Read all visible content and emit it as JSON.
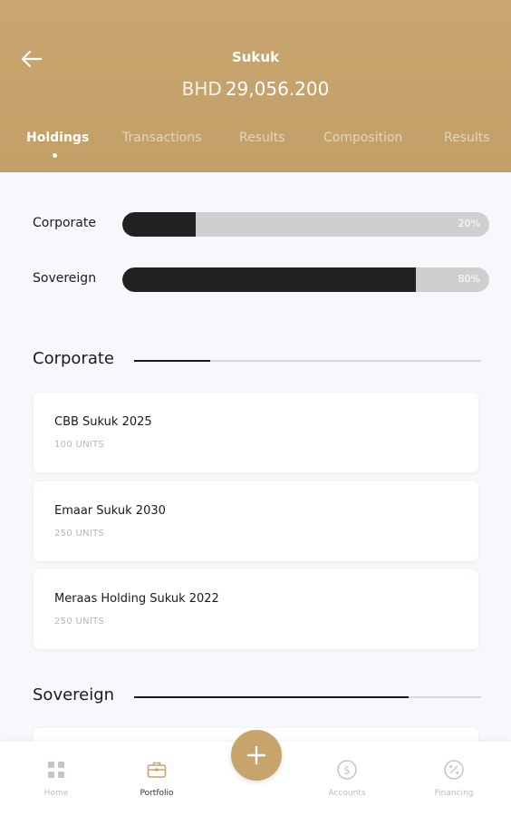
{
  "header": {
    "title": "Sukuk",
    "balance_currency": "BHD",
    "balance_amount": "29,056.200",
    "back_icon": "arrow-left-icon"
  },
  "tabs": [
    {
      "label": "Holdings",
      "active": true
    },
    {
      "label": "Transactions",
      "active": false
    },
    {
      "label": "Results",
      "active": false
    },
    {
      "label": "Composition",
      "active": false
    },
    {
      "label": "Results",
      "active": false
    }
  ],
  "allocation": [
    {
      "label": "Corporate",
      "percent_text": "20%",
      "fraction": 0.2
    },
    {
      "label": "Sovereign",
      "percent_text": "80%",
      "fraction": 0.8
    }
  ],
  "sections": {
    "corporate": {
      "title": "Corporate",
      "progress_fraction": 0.22,
      "items": [
        {
          "name": "CBB Sukuk 2025",
          "units": "100 UNITS"
        },
        {
          "name": "Emaar Sukuk 2030",
          "units": "250 UNITS"
        },
        {
          "name": "Meraas Holding Sukuk 2022",
          "units": "250 UNITS"
        }
      ]
    },
    "sovereign": {
      "title": "Sovereign",
      "progress_fraction": 0.79
    }
  },
  "bottom_nav": [
    {
      "label": "Home",
      "icon": "grid-icon",
      "active": false
    },
    {
      "label": "Portfolio",
      "icon": "briefcase-icon",
      "active": true
    },
    {
      "label": "Accounts",
      "icon": "dollar-circle-icon",
      "active": false
    },
    {
      "label": "Financing",
      "icon": "percent-circle-icon",
      "active": false
    }
  ],
  "fab": {
    "icon": "plus-icon"
  },
  "colors": {
    "header_gold": "#c9a66f",
    "fab_gold": "#c6a46c",
    "bar_fill": "#222222",
    "bar_track": "#cfcfcf"
  }
}
